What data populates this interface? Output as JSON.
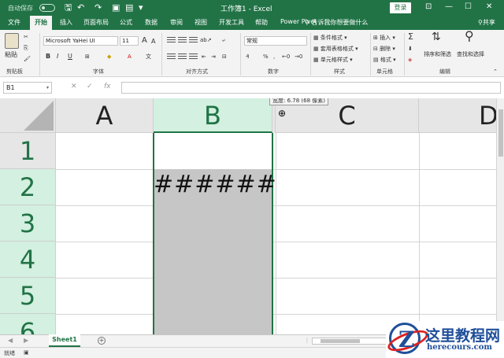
{
  "titlebar": {
    "autosave": "自动保存",
    "autosave_state": "关",
    "title": "工作簿1 - Excel",
    "login": "登录",
    "qat_icons": [
      "save-icon",
      "undo-icon",
      "redo-icon",
      "form-icon",
      "print-preview-icon",
      "customize-icon"
    ]
  },
  "tabs": [
    "文件",
    "开始",
    "插入",
    "页面布局",
    "公式",
    "数据",
    "审阅",
    "视图",
    "开发工具",
    "帮助",
    "Power Pivot"
  ],
  "active_tab": "开始",
  "tellme": "告诉我你想要做什么",
  "share": "共享",
  "ribbon": {
    "clipboard": {
      "paste": "粘贴",
      "label": "剪贴板"
    },
    "font": {
      "name": "Microsoft YaHei UI",
      "size": "11",
      "bold": "B",
      "italic": "I",
      "underline": "U",
      "grow": "A",
      "shrink": "A",
      "label": "字体"
    },
    "alignment": {
      "label": "对齐方式"
    },
    "number": {
      "format": "常规",
      "label": "数字"
    },
    "styles": {
      "conditional": "条件格式",
      "table": "套用表格格式",
      "cell": "单元格样式",
      "label": "样式"
    },
    "cells": {
      "insert": "插入",
      "delete": "删除",
      "format": "格式",
      "label": "单元格"
    },
    "editing": {
      "sort": "排序和筛选",
      "find": "查找和选择",
      "label": "编辑"
    }
  },
  "formula_bar": {
    "name_box": "B1",
    "cancel": "✕",
    "enter": "✓",
    "fx": "fx",
    "value": ""
  },
  "grid": {
    "columns": [
      "A",
      "B",
      "C",
      "D"
    ],
    "rows": [
      "1",
      "2",
      "3",
      "4",
      "5",
      "6"
    ],
    "cell_B2": "######",
    "tooltip": "宽度: 6.78 (68 像素)"
  },
  "sheets": [
    "Sheet1"
  ],
  "status": {
    "ready": "就绪"
  },
  "watermark": {
    "title": "这里教程网",
    "url": "herecours.com"
  },
  "colors": {
    "accent": "#217346",
    "selected_header": "#d3f0e0",
    "selection_fill": "#c6c6c6"
  }
}
